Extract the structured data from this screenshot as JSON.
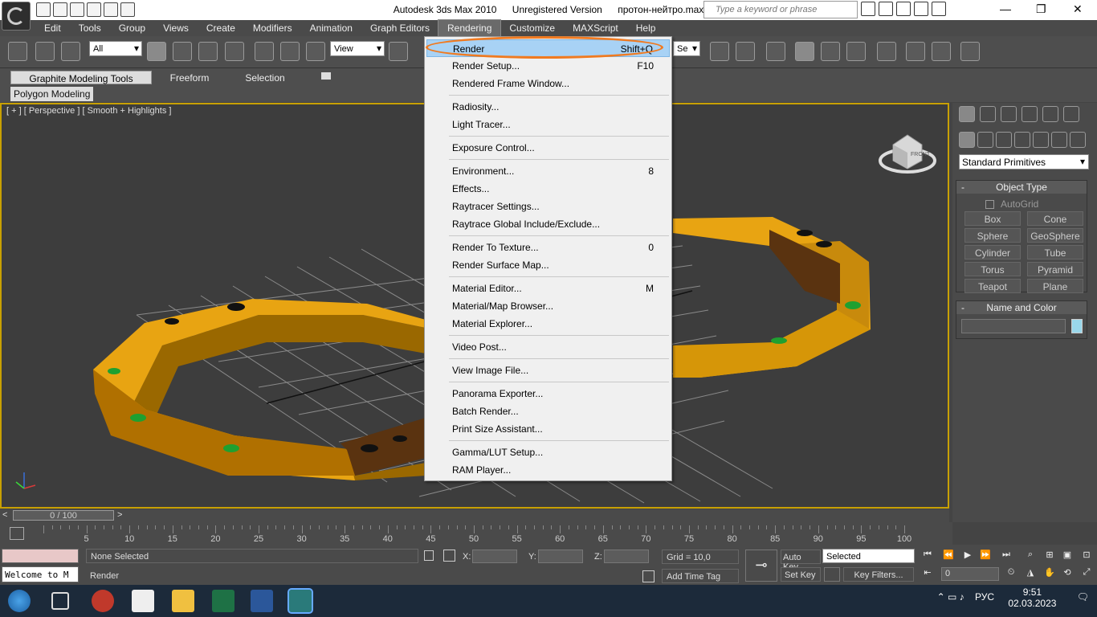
{
  "window": {
    "app_title": "Autodesk 3ds Max  2010",
    "license": "Unregistered Version",
    "file_name": "протон-нейтро.max",
    "search_placeholder": "Type a keyword or phrase"
  },
  "menubar": [
    "Edit",
    "Tools",
    "Group",
    "Views",
    "Create",
    "Modifiers",
    "Animation",
    "Graph Editors",
    "Rendering",
    "Customize",
    "MAXScript",
    "Help"
  ],
  "toolbar": {
    "selection_filter": "All",
    "ref_coord": "View",
    "named_sel": "Se"
  },
  "ribbon": {
    "tabs": [
      "Graphite Modeling Tools",
      "Freeform",
      "Selection"
    ],
    "subtab": "Polygon Modeling"
  },
  "viewport": {
    "label": "[ + ] [ Perspective ] [ Smooth + Highlights ]",
    "viewcube_label": "FRONT"
  },
  "rendering_menu": {
    "items": [
      {
        "label": "Render",
        "shortcut": "Shift+Q",
        "highlighted": true
      },
      {
        "label": "Render Setup...",
        "shortcut": "F10"
      },
      {
        "label": "Rendered Frame Window...",
        "shortcut": ""
      },
      {
        "label": "Radiosity...",
        "shortcut": "",
        "sep_before": true
      },
      {
        "label": "Light Tracer...",
        "shortcut": ""
      },
      {
        "label": "Exposure Control...",
        "shortcut": "",
        "sep_before": true
      },
      {
        "label": "Environment...",
        "shortcut": "8",
        "sep_before": true
      },
      {
        "label": "Effects...",
        "shortcut": ""
      },
      {
        "label": "Raytracer Settings...",
        "shortcut": ""
      },
      {
        "label": "Raytrace Global Include/Exclude...",
        "shortcut": ""
      },
      {
        "label": "Render To Texture...",
        "shortcut": "0",
        "sep_before": true
      },
      {
        "label": "Render Surface Map...",
        "shortcut": ""
      },
      {
        "label": "Material Editor...",
        "shortcut": "M",
        "sep_before": true
      },
      {
        "label": "Material/Map Browser...",
        "shortcut": ""
      },
      {
        "label": "Material Explorer...",
        "shortcut": ""
      },
      {
        "label": "Video Post...",
        "shortcut": "",
        "sep_before": true
      },
      {
        "label": "View Image File...",
        "shortcut": "",
        "sep_before": true
      },
      {
        "label": "Panorama Exporter...",
        "shortcut": "",
        "sep_before": true
      },
      {
        "label": "Batch Render...",
        "shortcut": ""
      },
      {
        "label": "Print Size Assistant...",
        "shortcut": ""
      },
      {
        "label": "Gamma/LUT Setup...",
        "shortcut": "",
        "sep_before": true
      },
      {
        "label": "RAM Player...",
        "shortcut": ""
      }
    ]
  },
  "command_panel": {
    "category": "Standard Primitives",
    "object_type_title": "Object Type",
    "autogrid": "AutoGrid",
    "buttons": [
      "Box",
      "Cone",
      "Sphere",
      "GeoSphere",
      "Cylinder",
      "Tube",
      "Torus",
      "Pyramid",
      "Teapot",
      "Plane"
    ],
    "name_color_title": "Name and Color",
    "object_color": "#9ad7ea"
  },
  "timeslider": {
    "frame": "0 / 100",
    "ticks": [
      "5",
      "10",
      "15",
      "20",
      "25",
      "30",
      "35",
      "40",
      "45",
      "50",
      "55",
      "60",
      "65",
      "70",
      "75",
      "80",
      "85",
      "90",
      "95",
      "100"
    ]
  },
  "status": {
    "selection": "None Selected",
    "prompt": "Render",
    "maxscript": "Welcome to M",
    "x_label": "X:",
    "y_label": "Y:",
    "z_label": "Z:",
    "grid": "Grid = 10,0",
    "add_time_tag": "Add Time Tag",
    "auto_key": "Auto Key",
    "set_key": "Set Key",
    "key_mode": "Selected",
    "key_filters": "Key Filters...",
    "current_frame": "0"
  },
  "taskbar": {
    "time": "9:51",
    "date": "02.03.2023",
    "lang": "РУС"
  },
  "colors": {
    "accent_orange": "#f07a20",
    "highlight": "#a8d2f5",
    "viewport_border": "#c8a000"
  }
}
